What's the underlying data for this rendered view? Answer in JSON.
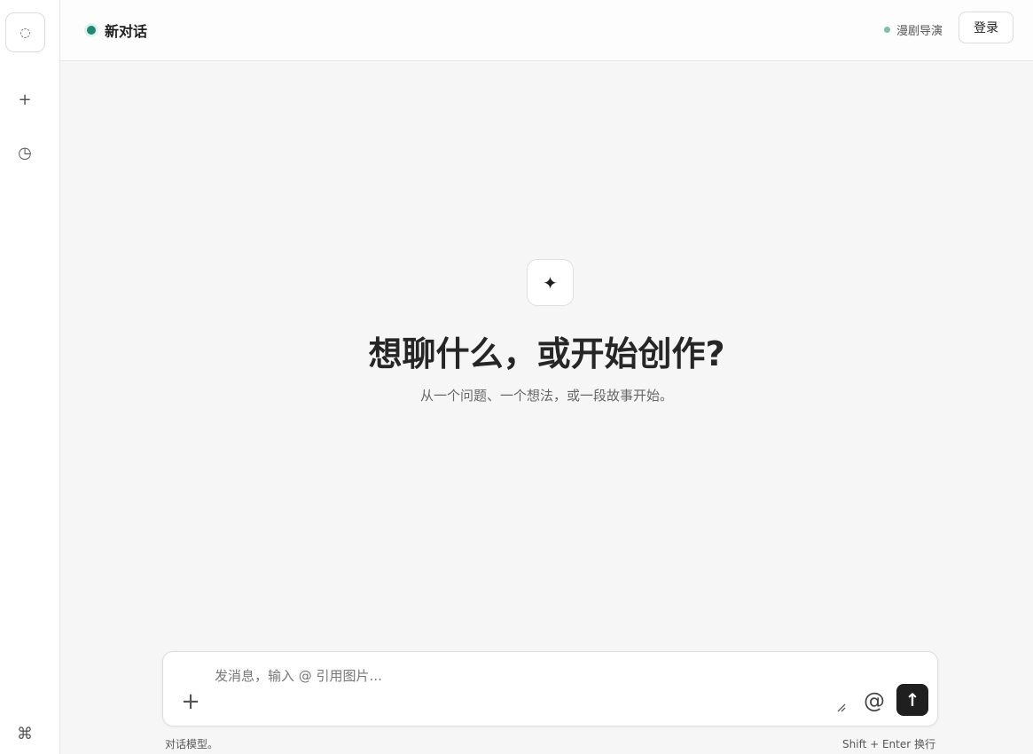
{
  "sidebar": {
    "logo_icon": "spinner-icon",
    "logo_glyph": "◌",
    "new_icon": "plus-icon",
    "new_glyph": "+",
    "history_icon": "clock-icon",
    "history_glyph": "◷",
    "shortcut_icon": "command-icon",
    "shortcut_glyph": "⌘"
  },
  "header": {
    "title": "新对话",
    "mode_label": "漫剧导演",
    "login_label": "登录"
  },
  "hero": {
    "icon_glyph": "✦",
    "title": "想聊什么，或开始创作?",
    "subtitle": "从一个问题、一个想法，或一段故事开始。"
  },
  "composer": {
    "placeholder": "发消息，输入 @ 引用图片...",
    "attach_glyph": "+",
    "mention_glyph": "@",
    "send_glyph": "↑",
    "footer_left": "对话模型。",
    "footer_right": "Shift + Enter 换行"
  },
  "colors": {
    "accent": "#1f8a73",
    "send_bg": "#1f1f1f",
    "page_bg": "#f6f6f6"
  }
}
